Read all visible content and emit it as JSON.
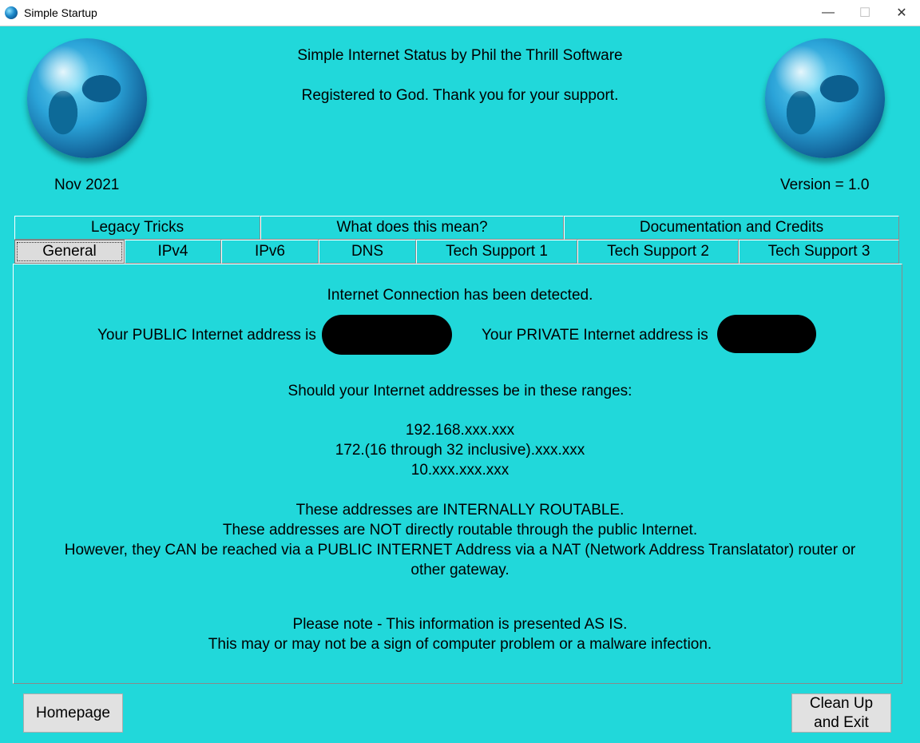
{
  "window": {
    "title": "Simple Startup",
    "controls": {
      "minimize": "—",
      "maximize": "☐",
      "close": "✕"
    }
  },
  "header": {
    "title": "Simple Internet Status by Phil the Thrill Software",
    "registration": "Registered to God.  Thank you for your support.",
    "date": "Nov 2021",
    "version": "Version = 1.0"
  },
  "tabs": {
    "row1": [
      "Legacy Tricks",
      "What does this mean?",
      "Documentation and Credits"
    ],
    "row2": [
      "General",
      "IPv4",
      "IPv6",
      "DNS",
      "Tech Support 1",
      "Tech Support 2",
      "Tech Support 3"
    ],
    "active": "General"
  },
  "general": {
    "detected": "Internet Connection has been detected.",
    "public_label": "Your PUBLIC Internet address is",
    "private_label": "Your PRIVATE Internet address is",
    "ranges_intro": "Should your Internet addresses be in these ranges:",
    "ranges": [
      "192.168.xxx.xxx",
      "172.(16 through 32 inclusive).xxx.xxx",
      "10.xxx.xxx.xxx"
    ],
    "explain": [
      "These addresses are INTERNALLY ROUTABLE.",
      "These addresses are NOT directly routable through the public Internet.",
      "However, they CAN be reached via a PUBLIC INTERNET Address via a NAT (Network Address Translatator) router or",
      "other gateway."
    ],
    "note": [
      "Please note - This information is presented AS IS.",
      "This may or may not be a sign of computer problem or a malware infection."
    ]
  },
  "buttons": {
    "homepage": "Homepage",
    "exit_line1": "Clean Up",
    "exit_line2": "and Exit"
  },
  "colors": {
    "background": "#21d8da",
    "button": "#e1e1e1"
  }
}
